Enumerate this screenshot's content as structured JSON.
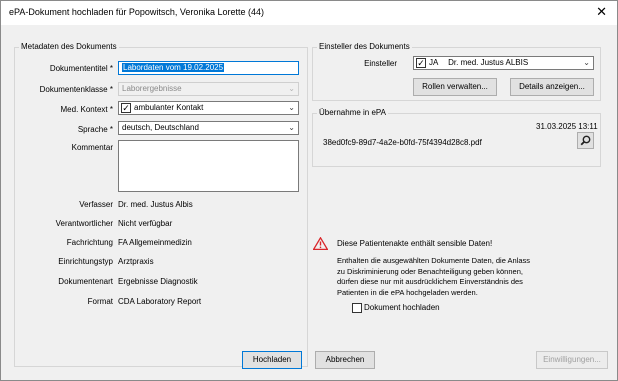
{
  "window": {
    "title": "ePA-Dokument hochladen für Popowitsch, Veronika Lorette (44)",
    "close_symbol": "✕"
  },
  "metadata": {
    "group_label": "Metadaten des Dokuments",
    "title_label": "Dokumententitel",
    "title_value": "Labordaten vom 19.02.2025",
    "class_label": "Dokumentenklasse",
    "class_value": "Laborergebnisse",
    "context_label": "Med. Kontext",
    "context_value": "ambulanter Kontakt",
    "language_label": "Sprache",
    "language_value": "deutsch, Deutschland",
    "comment_label": "Kommentar",
    "comment_value": "",
    "required_marker": "*",
    "rows": [
      {
        "label": "Verfasser",
        "value": "Dr. med. Justus Albis"
      },
      {
        "label": "Verantwortlicher",
        "value": "Nicht verfügbar"
      },
      {
        "label": "Fachrichtung",
        "value": "FA Allgemeinmedizin"
      },
      {
        "label": "Einrichtungstyp",
        "value": "Arztpraxis"
      },
      {
        "label": "Dokumentenart",
        "value": "Ergebnisse Diagnostik"
      },
      {
        "label": "Format",
        "value": "CDA Laboratory Report"
      }
    ]
  },
  "einsteller": {
    "group_label": "Einsteller des Dokuments",
    "label": "Einsteller",
    "ja": "JA",
    "value": "Dr. med. Justus ALBIS",
    "roles_button": "Rollen verwalten...",
    "details_button": "Details anzeigen..."
  },
  "uebernahme": {
    "group_label": "Übernahme in ePA",
    "timestamp": "31.03.2025 13:11",
    "filename": "38ed0fc9-89d7-4a2e-b0fd-75f4394d28c8.pdf"
  },
  "warning": {
    "headline": "Diese Patientenakte enthält sensible Daten!",
    "body_lines": [
      "Enthalten die ausgewählten Dokumente Daten, die Anlass",
      "zu Diskriminierung oder Benachteiligung geben können,",
      "dürfen diese nur mit ausdrücklichem Einverständnis des",
      "Patienten in die ePA hochgeladen werden."
    ],
    "checkbox_label": "Dokument hochladen"
  },
  "footer": {
    "upload_button": "Hochladen",
    "cancel_button": "Abbrechen",
    "consent_button": "Einwilligungen..."
  },
  "colors": {
    "accent": "#0078d7",
    "warning": "#d9262b"
  },
  "icons": {
    "dropdown": "chevron-down-icon",
    "checkbox_checked": "check-icon",
    "search": "magnifier-icon",
    "warning": "warning-triangle-icon",
    "close": "close-icon"
  }
}
